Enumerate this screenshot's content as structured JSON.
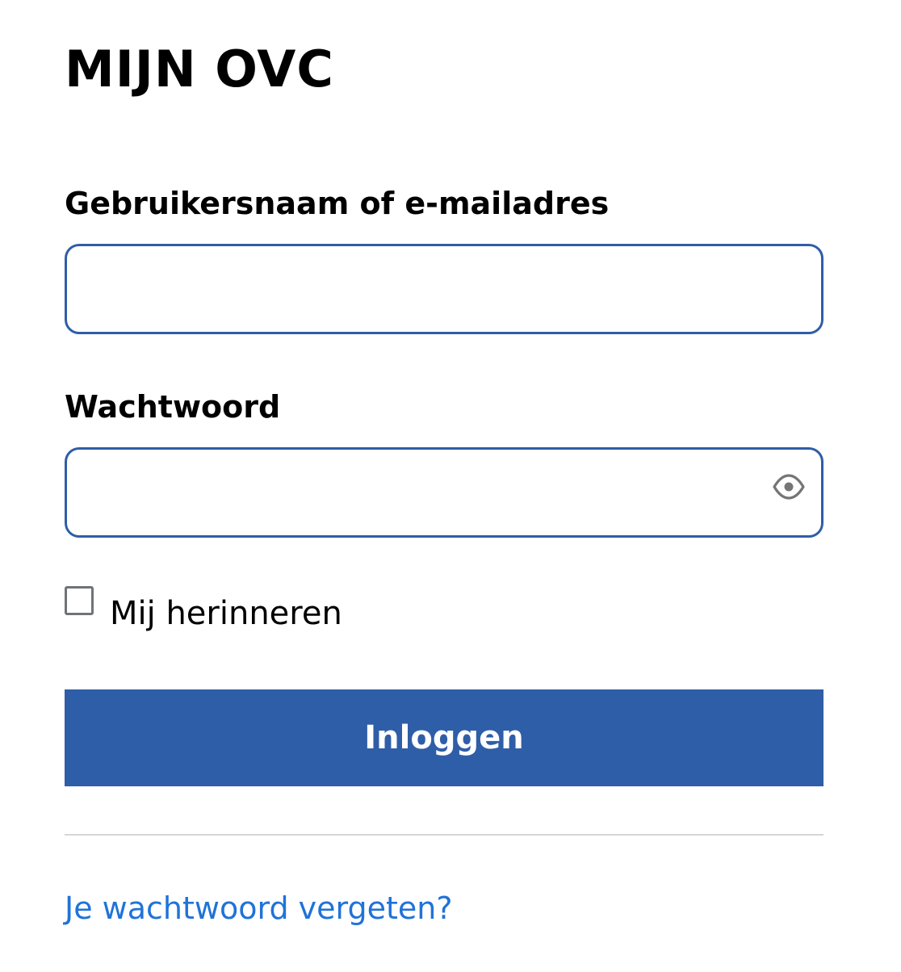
{
  "brand": {
    "title": "MIJN OVC"
  },
  "form": {
    "username_label": "Gebruikersnaam of e-mailadres",
    "username_value": "",
    "password_label": "Wachtwoord",
    "password_value": "",
    "password_toggle_icon": "eye-icon",
    "remember_label": "Mij herinneren",
    "remember_checked": false,
    "submit_label": "Inloggen",
    "forgot_link": "Je wachtwoord vergeten?"
  },
  "colors": {
    "accent": "#2f5ea8",
    "link": "#1f73d8",
    "field_border": "#2f5ea6",
    "checkbox_border": "#6f7478",
    "divider": "#d6d6d6"
  }
}
